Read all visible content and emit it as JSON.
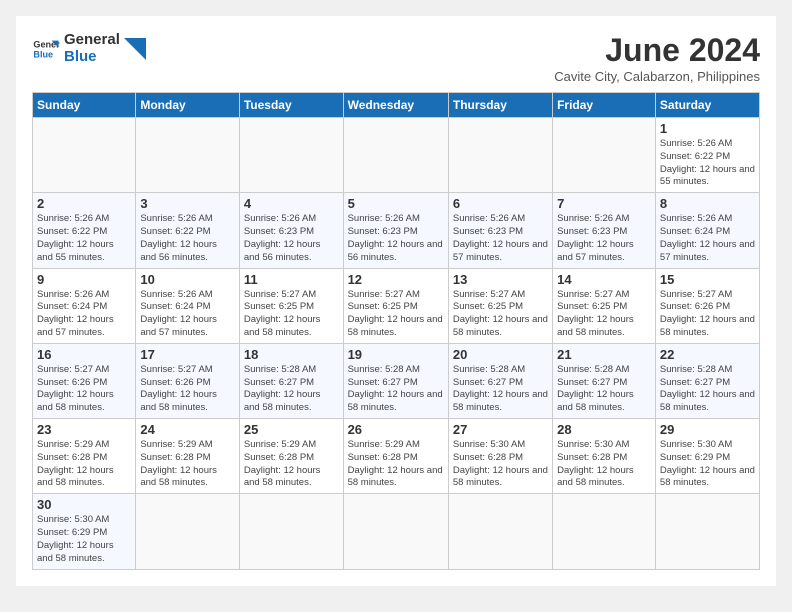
{
  "logo": {
    "text_general": "General",
    "text_blue": "Blue"
  },
  "header": {
    "title": "June 2024",
    "subtitle": "Cavite City, Calabarzon, Philippines"
  },
  "weekdays": [
    "Sunday",
    "Monday",
    "Tuesday",
    "Wednesday",
    "Thursday",
    "Friday",
    "Saturday"
  ],
  "weeks": [
    [
      {
        "day": "",
        "empty": true
      },
      {
        "day": "",
        "empty": true
      },
      {
        "day": "",
        "empty": true
      },
      {
        "day": "",
        "empty": true
      },
      {
        "day": "",
        "empty": true
      },
      {
        "day": "",
        "empty": true
      },
      {
        "day": "1",
        "sunrise": "5:26 AM",
        "sunset": "6:22 PM",
        "daylight": "12 hours and 55 minutes."
      }
    ],
    [
      {
        "day": "2",
        "sunrise": "5:26 AM",
        "sunset": "6:22 PM",
        "daylight": "12 hours and 55 minutes."
      },
      {
        "day": "3",
        "sunrise": "5:26 AM",
        "sunset": "6:22 PM",
        "daylight": "12 hours and 56 minutes."
      },
      {
        "day": "4",
        "sunrise": "5:26 AM",
        "sunset": "6:23 PM",
        "daylight": "12 hours and 56 minutes."
      },
      {
        "day": "5",
        "sunrise": "5:26 AM",
        "sunset": "6:23 PM",
        "daylight": "12 hours and 56 minutes."
      },
      {
        "day": "6",
        "sunrise": "5:26 AM",
        "sunset": "6:23 PM",
        "daylight": "12 hours and 57 minutes."
      },
      {
        "day": "7",
        "sunrise": "5:26 AM",
        "sunset": "6:23 PM",
        "daylight": "12 hours and 57 minutes."
      },
      {
        "day": "8",
        "sunrise": "5:26 AM",
        "sunset": "6:24 PM",
        "daylight": "12 hours and 57 minutes."
      }
    ],
    [
      {
        "day": "9",
        "sunrise": "5:26 AM",
        "sunset": "6:24 PM",
        "daylight": "12 hours and 57 minutes."
      },
      {
        "day": "10",
        "sunrise": "5:26 AM",
        "sunset": "6:24 PM",
        "daylight": "12 hours and 57 minutes."
      },
      {
        "day": "11",
        "sunrise": "5:27 AM",
        "sunset": "6:25 PM",
        "daylight": "12 hours and 58 minutes."
      },
      {
        "day": "12",
        "sunrise": "5:27 AM",
        "sunset": "6:25 PM",
        "daylight": "12 hours and 58 minutes."
      },
      {
        "day": "13",
        "sunrise": "5:27 AM",
        "sunset": "6:25 PM",
        "daylight": "12 hours and 58 minutes."
      },
      {
        "day": "14",
        "sunrise": "5:27 AM",
        "sunset": "6:25 PM",
        "daylight": "12 hours and 58 minutes."
      },
      {
        "day": "15",
        "sunrise": "5:27 AM",
        "sunset": "6:26 PM",
        "daylight": "12 hours and 58 minutes."
      }
    ],
    [
      {
        "day": "16",
        "sunrise": "5:27 AM",
        "sunset": "6:26 PM",
        "daylight": "12 hours and 58 minutes."
      },
      {
        "day": "17",
        "sunrise": "5:27 AM",
        "sunset": "6:26 PM",
        "daylight": "12 hours and 58 minutes."
      },
      {
        "day": "18",
        "sunrise": "5:28 AM",
        "sunset": "6:27 PM",
        "daylight": "12 hours and 58 minutes."
      },
      {
        "day": "19",
        "sunrise": "5:28 AM",
        "sunset": "6:27 PM",
        "daylight": "12 hours and 58 minutes."
      },
      {
        "day": "20",
        "sunrise": "5:28 AM",
        "sunset": "6:27 PM",
        "daylight": "12 hours and 58 minutes."
      },
      {
        "day": "21",
        "sunrise": "5:28 AM",
        "sunset": "6:27 PM",
        "daylight": "12 hours and 58 minutes."
      },
      {
        "day": "22",
        "sunrise": "5:28 AM",
        "sunset": "6:27 PM",
        "daylight": "12 hours and 58 minutes."
      }
    ],
    [
      {
        "day": "23",
        "sunrise": "5:29 AM",
        "sunset": "6:28 PM",
        "daylight": "12 hours and 58 minutes."
      },
      {
        "day": "24",
        "sunrise": "5:29 AM",
        "sunset": "6:28 PM",
        "daylight": "12 hours and 58 minutes."
      },
      {
        "day": "25",
        "sunrise": "5:29 AM",
        "sunset": "6:28 PM",
        "daylight": "12 hours and 58 minutes."
      },
      {
        "day": "26",
        "sunrise": "5:29 AM",
        "sunset": "6:28 PM",
        "daylight": "12 hours and 58 minutes."
      },
      {
        "day": "27",
        "sunrise": "5:30 AM",
        "sunset": "6:28 PM",
        "daylight": "12 hours and 58 minutes."
      },
      {
        "day": "28",
        "sunrise": "5:30 AM",
        "sunset": "6:28 PM",
        "daylight": "12 hours and 58 minutes."
      },
      {
        "day": "29",
        "sunrise": "5:30 AM",
        "sunset": "6:29 PM",
        "daylight": "12 hours and 58 minutes."
      }
    ],
    [
      {
        "day": "30",
        "sunrise": "5:30 AM",
        "sunset": "6:29 PM",
        "daylight": "12 hours and 58 minutes."
      },
      {
        "day": "",
        "empty": true
      },
      {
        "day": "",
        "empty": true
      },
      {
        "day": "",
        "empty": true
      },
      {
        "day": "",
        "empty": true
      },
      {
        "day": "",
        "empty": true
      },
      {
        "day": "",
        "empty": true
      }
    ]
  ]
}
